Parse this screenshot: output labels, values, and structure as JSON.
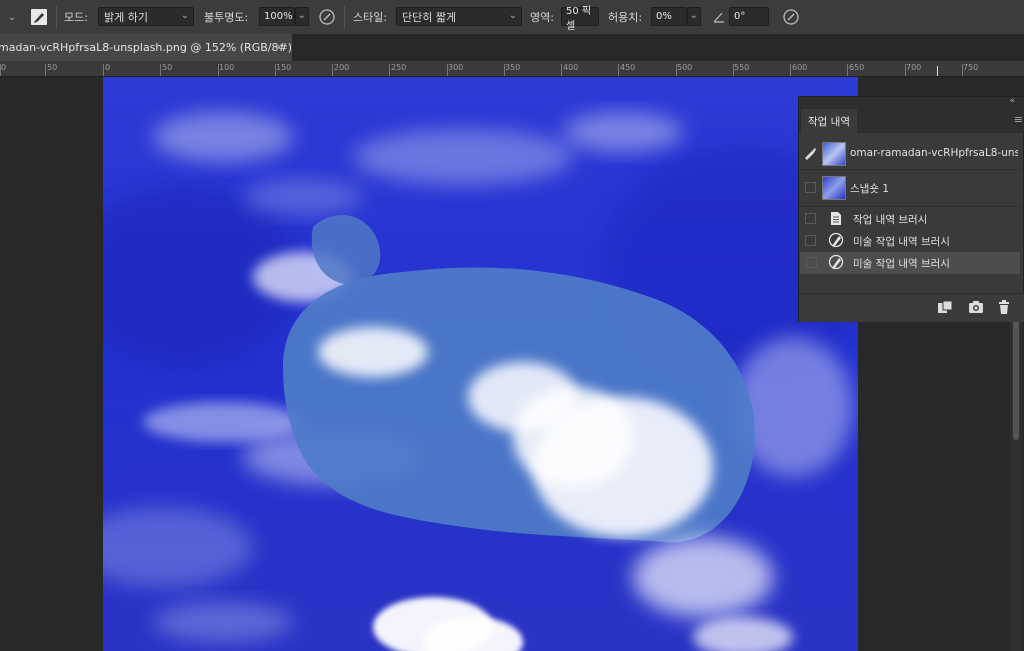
{
  "options_bar": {
    "mode_label": "모드:",
    "mode_value": "밝게 하기",
    "opacity_label": "불투명도:",
    "opacity_value": "100%",
    "style_label": "스타일:",
    "style_value": "단단히 짧게",
    "area_label": "영역:",
    "area_value": "50 픽셀",
    "tolerance_label": "허용치:",
    "tolerance_value": "0%",
    "angle_value": "0°"
  },
  "document_tab": {
    "title": "madan-vcRHpfrsaL8-unsplash.png @ 152% (RGB/8#) *",
    "close": "×"
  },
  "ruler": {
    "labels": [
      "0",
      "50",
      "0",
      "50",
      "100",
      "150",
      "200",
      "250",
      "300",
      "350",
      "400",
      "450",
      "500",
      "550",
      "600",
      "650",
      "700",
      "750"
    ]
  },
  "history_panel": {
    "tab_label": "작업 내역",
    "items": [
      {
        "label": "omar-ramadan-vcRHpfrsaL8-uns...",
        "icon": "snapshot-thumbnail"
      },
      {
        "label": "스냅숏 1",
        "icon": "snapshot-thumbnail"
      },
      {
        "label": "작업 내역 브러시",
        "icon": "document-icon"
      },
      {
        "label": "미술 작업 내역 브러시",
        "icon": "art-history-brush-icon"
      },
      {
        "label": "미술 작업 내역 브러시",
        "icon": "art-history-brush-icon"
      }
    ],
    "selected_index": 4
  },
  "colors": {
    "sky_blue": "#2a35d6",
    "panel_bg": "#3a3a3a",
    "selected_row": "#4d4d4d"
  }
}
